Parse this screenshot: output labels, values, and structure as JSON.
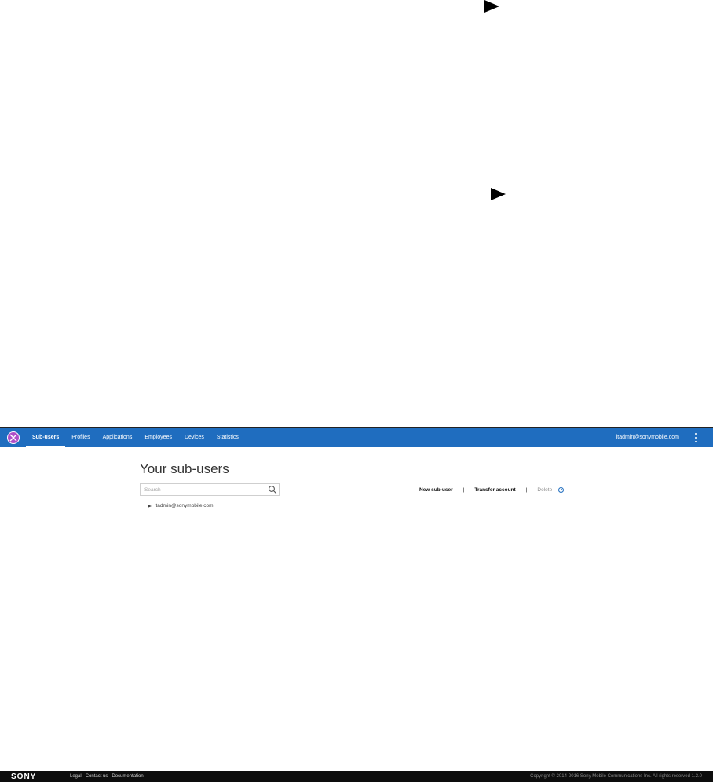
{
  "nav": {
    "items": [
      {
        "label": "Sub-users",
        "active": true
      },
      {
        "label": "Profiles"
      },
      {
        "label": "Applications"
      },
      {
        "label": "Employees"
      },
      {
        "label": "Devices"
      },
      {
        "label": "Statistics"
      }
    ]
  },
  "account": {
    "email": "itadmin@sonymobile.com"
  },
  "main": {
    "title": "Your sub-users"
  },
  "search": {
    "placeholder": "Search"
  },
  "actions": {
    "new_sub_user": "New sub-user",
    "separator": "|",
    "transfer_account": "Transfer account",
    "delete": "Delete"
  },
  "tree": {
    "items": [
      {
        "label": "itadmin@sonymobile.com"
      }
    ]
  },
  "footer": {
    "logo": "SONY",
    "links": [
      "Legal",
      "Contact us",
      "Documentation"
    ],
    "copyright": "Copyright © 2014-2016 Sony Mobile Communications Inc. All rights reserved 1.2.0"
  },
  "colors": {
    "accent": "#1f6dbf",
    "footer_bg": "#0d0d0d"
  }
}
